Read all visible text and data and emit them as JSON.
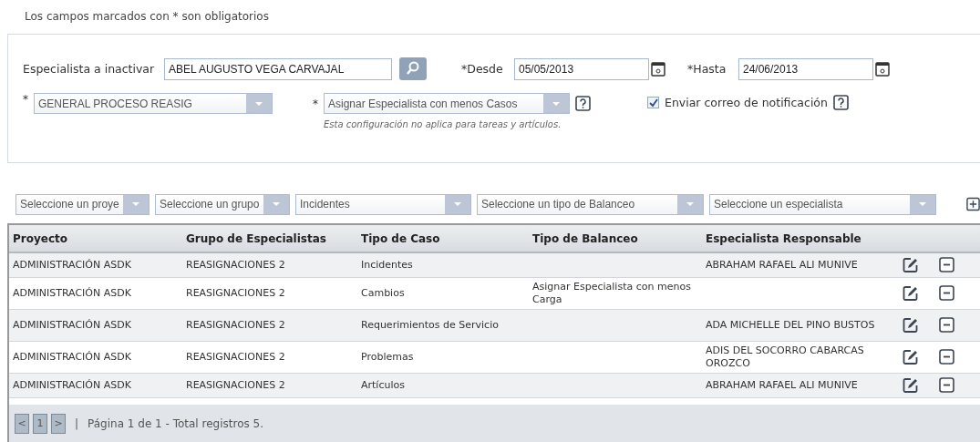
{
  "note": "Los campos marcados con * son obligatorios",
  "form": {
    "specialist": {
      "label": "Especialista a inactivar",
      "value": "ABEL AUGUSTO VEGA CARVAJAL"
    },
    "from": {
      "label": "*Desde",
      "value": "05/05/2013"
    },
    "to": {
      "label": "*Hasta",
      "value": "24/06/2013"
    },
    "process_select": {
      "mark": "*",
      "value": "GENERAL PROCESO REASIG"
    },
    "strategy_select": {
      "mark": "*",
      "value": "Asignar Especialista con menos Casos",
      "hint": "Esta configuración no aplica para tareas y artículos."
    },
    "notify": {
      "label": "Enviar correo de notificación",
      "checked": true
    }
  },
  "filters": [
    {
      "value": "Seleccione un proye"
    },
    {
      "value": "Seleccione un grupo"
    },
    {
      "value": "Incidentes"
    },
    {
      "value": "Seleccione un tipo de Balanceo"
    },
    {
      "value": "Seleccione un especialista"
    }
  ],
  "table": {
    "columns": [
      "Proyecto",
      "Grupo de Especialistas",
      "Tipo de Caso",
      "Tipo de Balanceo",
      "Especialista Responsable"
    ],
    "rows": [
      [
        "ADMINISTRACIÓN ASDK",
        "REASIGNACIONES 2",
        "Incidentes",
        "",
        "ABRAHAM RAFAEL ALI MUNIVE"
      ],
      [
        "ADMINISTRACIÓN ASDK",
        "REASIGNACIONES 2",
        "Cambios",
        "Asignar Especialista con menos Carga",
        ""
      ],
      [
        "ADMINISTRACIÓN ASDK",
        "REASIGNACIONES 2",
        "Requerimientos de Servicio",
        "",
        "ADA MICHELLE DEL PINO BUSTOS"
      ],
      [
        "ADMINISTRACIÓN ASDK",
        "REASIGNACIONES 2",
        "Problemas",
        "",
        "ADIS DEL SOCORRO CABARCAS OROZCO"
      ],
      [
        "ADMINISTRACIÓN ASDK",
        "REASIGNACIONES 2",
        "Artículos",
        "",
        "ABRAHAM RAFAEL ALI MUNIVE"
      ]
    ]
  },
  "pagination": {
    "buttons": [
      "<",
      "1",
      ">"
    ],
    "separator": "|",
    "summary": "Página 1 de 1 - Total registros 5."
  }
}
